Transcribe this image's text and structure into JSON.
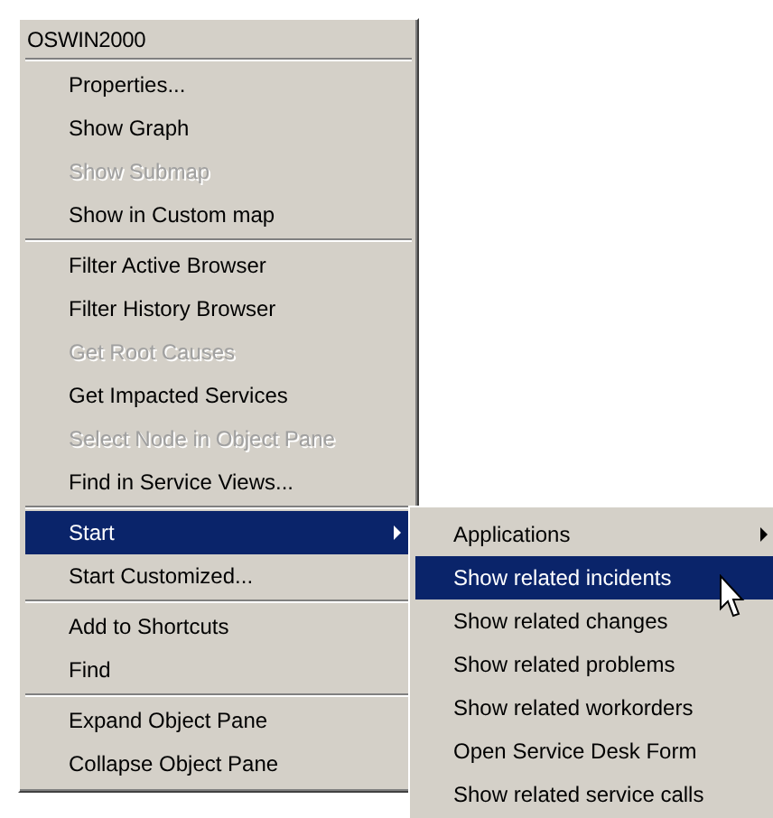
{
  "menu": {
    "title": "OSWIN2000",
    "items": [
      {
        "kind": "item",
        "label": "Properties...",
        "disabled": false,
        "selected": false,
        "has_submenu": false
      },
      {
        "kind": "item",
        "label": "Show Graph",
        "disabled": false,
        "selected": false,
        "has_submenu": false
      },
      {
        "kind": "item",
        "label": "Show Submap",
        "disabled": true,
        "selected": false,
        "has_submenu": false
      },
      {
        "kind": "item",
        "label": "Show in Custom map",
        "disabled": false,
        "selected": false,
        "has_submenu": false
      },
      {
        "kind": "separator"
      },
      {
        "kind": "item",
        "label": "Filter Active Browser",
        "disabled": false,
        "selected": false,
        "has_submenu": false
      },
      {
        "kind": "item",
        "label": "Filter History Browser",
        "disabled": false,
        "selected": false,
        "has_submenu": false
      },
      {
        "kind": "item",
        "label": "Get Root Causes",
        "disabled": true,
        "selected": false,
        "has_submenu": false
      },
      {
        "kind": "item",
        "label": "Get Impacted Services",
        "disabled": false,
        "selected": false,
        "has_submenu": false
      },
      {
        "kind": "item",
        "label": "Select Node in Object Pane",
        "disabled": true,
        "selected": false,
        "has_submenu": false
      },
      {
        "kind": "item",
        "label": "Find in Service Views...",
        "disabled": false,
        "selected": false,
        "has_submenu": false
      },
      {
        "kind": "separator"
      },
      {
        "kind": "item",
        "label": "Start",
        "disabled": false,
        "selected": true,
        "has_submenu": true
      },
      {
        "kind": "item",
        "label": "Start Customized...",
        "disabled": false,
        "selected": false,
        "has_submenu": false
      },
      {
        "kind": "separator"
      },
      {
        "kind": "item",
        "label": "Add to Shortcuts",
        "disabled": false,
        "selected": false,
        "has_submenu": false
      },
      {
        "kind": "item",
        "label": "Find",
        "disabled": false,
        "selected": false,
        "has_submenu": false
      },
      {
        "kind": "separator"
      },
      {
        "kind": "item",
        "label": "Expand Object Pane",
        "disabled": false,
        "selected": false,
        "has_submenu": false
      },
      {
        "kind": "item",
        "label": "Collapse Object Pane",
        "disabled": false,
        "selected": false,
        "has_submenu": false
      }
    ]
  },
  "submenu": {
    "items": [
      {
        "label": "Applications",
        "selected": false,
        "has_submenu": true
      },
      {
        "label": "Show related incidents",
        "selected": true,
        "has_submenu": false
      },
      {
        "label": "Show related changes",
        "selected": false,
        "has_submenu": false
      },
      {
        "label": "Show related problems",
        "selected": false,
        "has_submenu": false
      },
      {
        "label": "Show related workorders",
        "selected": false,
        "has_submenu": false
      },
      {
        "label": "Open Service Desk Form",
        "selected": false,
        "has_submenu": false
      },
      {
        "label": "Show related service calls",
        "selected": false,
        "has_submenu": false
      }
    ]
  }
}
